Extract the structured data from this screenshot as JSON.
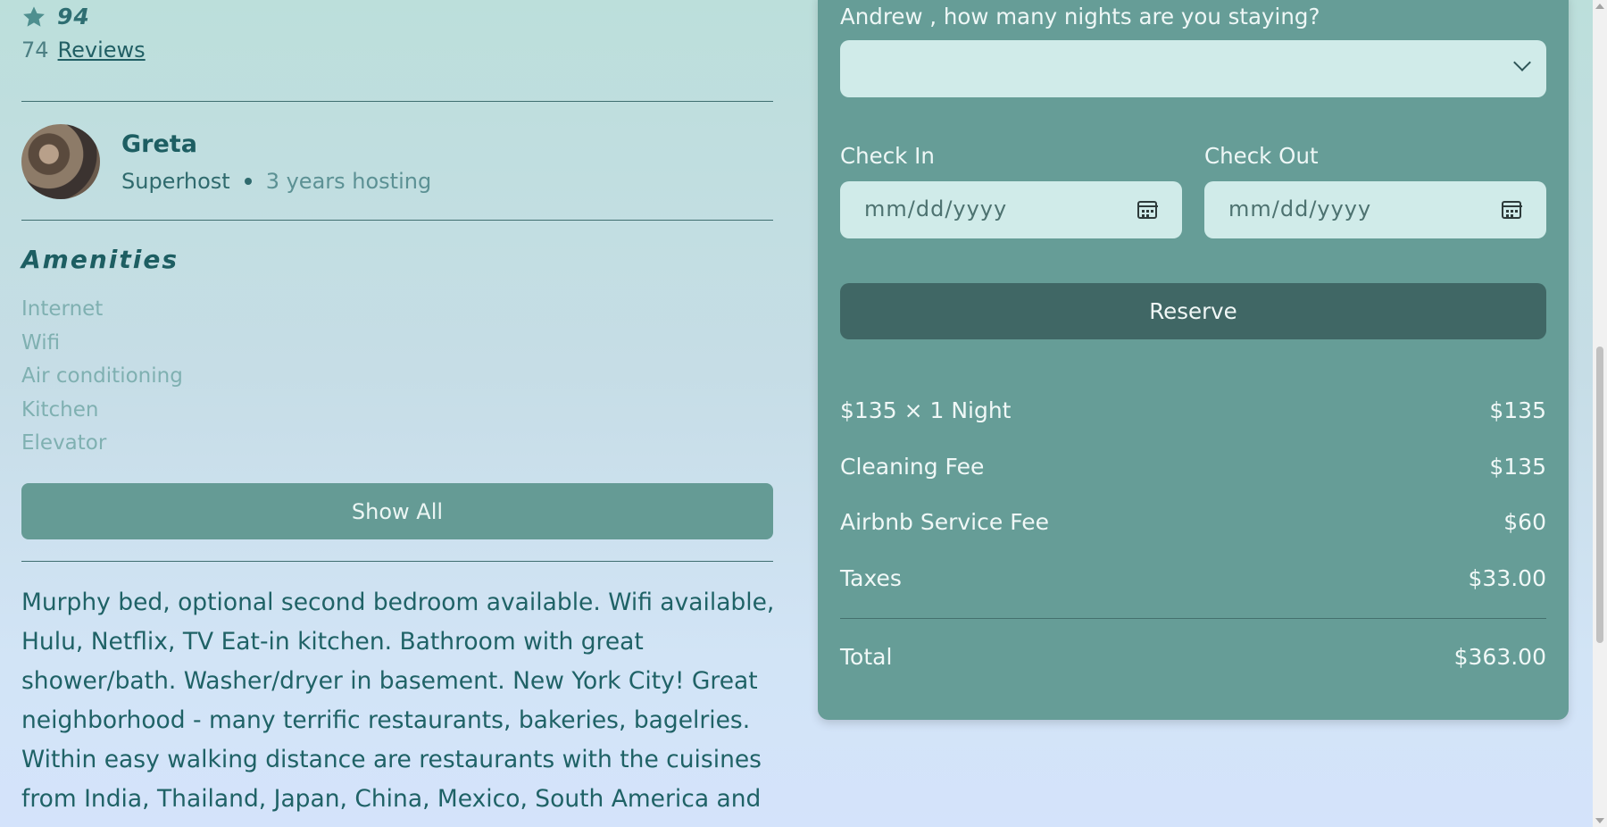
{
  "listing": {
    "rating": "94",
    "reviews_count": "74",
    "reviews_link": "Reviews"
  },
  "host": {
    "name": "Greta",
    "badge": "Superhost",
    "years": "3 years hosting"
  },
  "amenities": {
    "title": "Amenities",
    "items": [
      "Internet",
      "Wifi",
      "Air conditioning",
      "Kitchen",
      "Elevator"
    ],
    "show_all_label": "Show All"
  },
  "description": "Murphy bed, optional second bedroom available. Wifi available, Hulu, Netflix, TV Eat-in kitchen. Bathroom with great shower/bath. Washer/dryer in basement. New York City! Great neighborhood - many terrific restaurants, bakeries, bagelries. Within easy walking distance are restaurants with the cuisines from India, Thailand, Japan, China, Mexico, South America and",
  "booking": {
    "nights_question": "Andrew , how many nights are you staying?",
    "nights_selected": "",
    "check_in_label": "Check In",
    "check_out_label": "Check Out",
    "date_placeholder": "mm/dd/yyyy",
    "reserve_label": "Reserve",
    "fees": [
      {
        "label": "$135 × 1 Night",
        "amount": "$135"
      },
      {
        "label": "Cleaning Fee",
        "amount": "$135"
      },
      {
        "label": "Airbnb Service Fee",
        "amount": "$60"
      },
      {
        "label": "Taxes",
        "amount": "$33.00"
      }
    ],
    "total_label": "Total",
    "total_amount": "$363.00"
  },
  "icons": {
    "rating": "star-icon",
    "select": "chevron-down-icon",
    "date": "calendar-icon"
  },
  "colors": {
    "accent": "#669d97",
    "reserve": "#406765",
    "text": "#1f6266"
  }
}
